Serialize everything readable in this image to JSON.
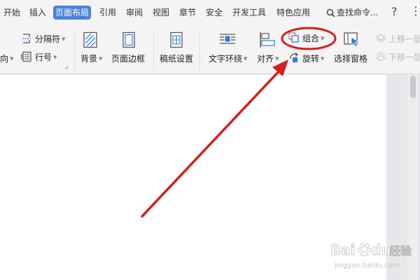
{
  "menu": {
    "items": [
      "开始",
      "插入",
      "页面布局",
      "引用",
      "审阅",
      "视图",
      "章节",
      "安全",
      "开发工具",
      "特色应用"
    ],
    "active_item": "页面布局",
    "search_label": "查找命令...",
    "help_label": "?",
    "more_label": "⋮"
  },
  "ribbon": {
    "direction_label": "向",
    "separator_label": "分隔符",
    "line_number_label": "行号",
    "background_label": "背景",
    "page_border_label": "页面边框",
    "manuscript_label": "稿纸设置",
    "text_wrap_label": "文字环绕",
    "align_label": "对齐",
    "group_label": "组合",
    "rotate_label": "旋转",
    "selection_pane_label": "选择窗格",
    "bring_forward_label": "上移一层",
    "send_backward_label": "下移一层"
  },
  "watermark": {
    "brand_text": "Baidu 经验",
    "url_text": "jingyan.baidu.com"
  },
  "colors": {
    "active_tab": "#4a84d9",
    "annotation": "#d81e1e",
    "ribbon_bg": "#f4f4f5",
    "page_bg": "#ffffff"
  }
}
